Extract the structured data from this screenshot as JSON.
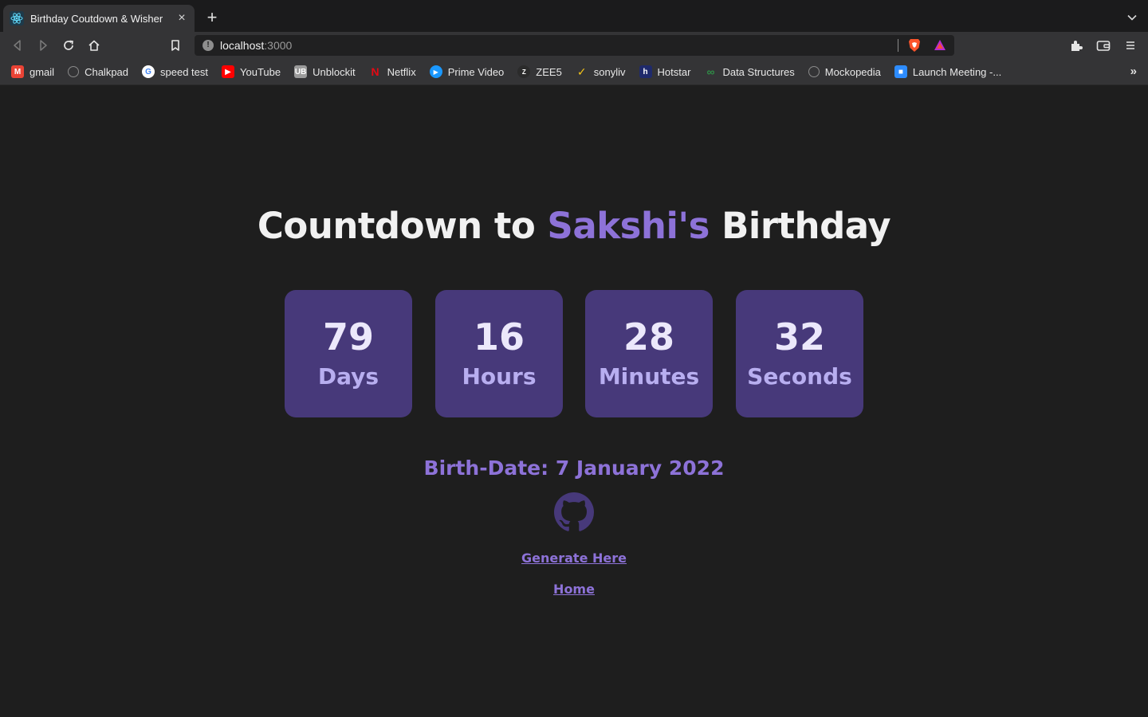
{
  "browser": {
    "tab": {
      "title": "Birthday Coutdown & Wisher",
      "close": "×"
    },
    "new_tab": "+",
    "address": {
      "host": "localhost",
      "port": ":3000"
    },
    "bookmarks": [
      {
        "label": "gmail",
        "icon": "gmail-icon",
        "color": "#ea4335",
        "glyph": "M"
      },
      {
        "label": "Chalkpad",
        "icon": "globe-icon",
        "color": "#8a8a8a",
        "glyph": ""
      },
      {
        "label": "speed test",
        "icon": "google-icon",
        "color": "#ffffff",
        "glyph": "G"
      },
      {
        "label": "YouTube",
        "icon": "youtube-icon",
        "color": "#ff0000",
        "glyph": "▶"
      },
      {
        "label": "Unblockit",
        "icon": "unblockit-icon",
        "color": "#9b9b9b",
        "glyph": "UB"
      },
      {
        "label": "Netflix",
        "icon": "netflix-icon",
        "color": "#e50914",
        "glyph": "N"
      },
      {
        "label": "Prime Video",
        "icon": "prime-video-icon",
        "color": "#1a98ff",
        "glyph": "▶"
      },
      {
        "label": "ZEE5",
        "icon": "zee5-icon",
        "color": "#2b2b2b",
        "glyph": "Z"
      },
      {
        "label": "sonyliv",
        "icon": "sonyliv-icon",
        "color": "#f5c518",
        "glyph": "✓"
      },
      {
        "label": "Hotstar",
        "icon": "hotstar-icon",
        "color": "#1f2a6b",
        "glyph": "h"
      },
      {
        "label": "Data Structures",
        "icon": "gfg-icon",
        "color": "#2f8d46",
        "glyph": "∞"
      },
      {
        "label": "Mockopedia",
        "icon": "globe-icon",
        "color": "#8a8a8a",
        "glyph": ""
      },
      {
        "label": "Launch Meeting -...",
        "icon": "zoom-icon",
        "color": "#2d8cff",
        "glyph": "■"
      }
    ],
    "bookmarks_more": "»"
  },
  "page": {
    "heading": {
      "prefix": "Countdown to ",
      "name": "Sakshi's",
      "suffix": " Birthday"
    },
    "countdown": [
      {
        "value": "79",
        "unit": "Days"
      },
      {
        "value": "16",
        "unit": "Hours"
      },
      {
        "value": "28",
        "unit": "Minutes"
      },
      {
        "value": "32",
        "unit": "Seconds"
      }
    ],
    "birthdate": "Birth-Date: 7 January 2022",
    "github_icon": "github-icon",
    "links": {
      "generate": "Generate Here",
      "home": "Home"
    }
  },
  "colors": {
    "background": "#1e1e1e",
    "accent": "#8d72d8",
    "box": "#47397a",
    "box_number": "#ece8fb",
    "box_unit": "#b8aef0"
  }
}
